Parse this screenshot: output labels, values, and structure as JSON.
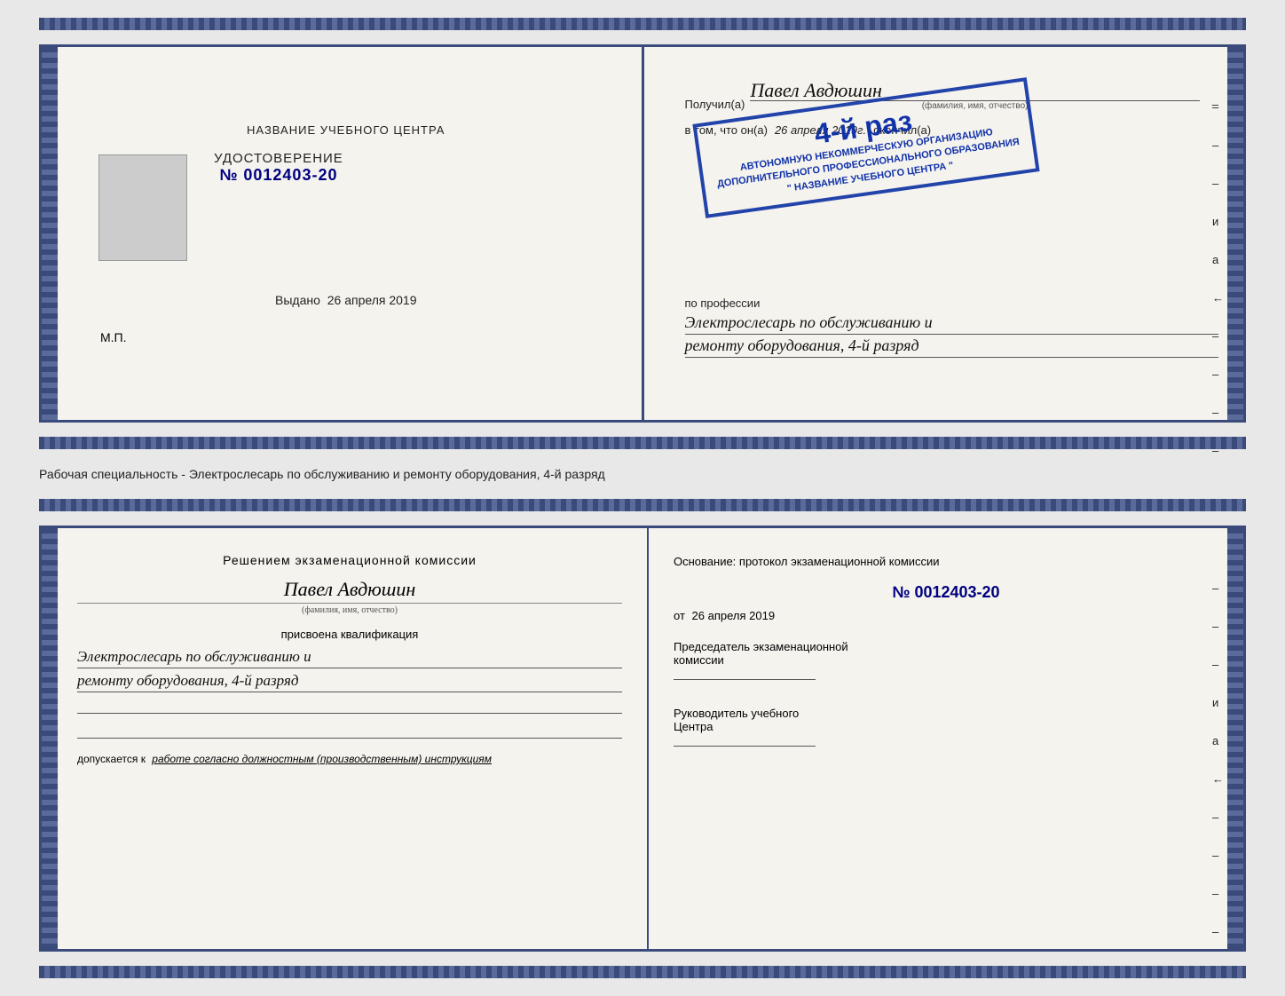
{
  "top_booklet": {
    "left": {
      "center_title": "НАЗВАНИЕ УЧЕБНОГО ЦЕНТРА",
      "doc_label": "УДОСТОВЕРЕНИЕ",
      "doc_number": "№ 0012403-20",
      "vydano_label": "Выдано",
      "vydano_date": "26 апреля 2019",
      "mp_text": "М.П."
    },
    "right": {
      "poluchil_label": "Получил(a)",
      "recipient_name": "Павел Авдюшин",
      "fio_sublabel": "(фамилия, имя, отчество)",
      "vtom_label": "в том, что он(a)",
      "date_italic": "26 апреля 2019г.",
      "okonchil_label": "окончил(a)",
      "stamp_line1": "4-й раз",
      "stamp_org1": "АВТОНОМНУЮ НЕКОММЕРЧЕСКУЮ ОРГАНИЗАЦИЮ",
      "stamp_org2": "ДОПОЛНИТЕЛЬНОГО ПРОФЕССИОНАЛЬНОГО ОБРАЗОВАНИЯ",
      "stamp_name": "\" НАЗВАНИЕ УЧЕБНОГО ЦЕНТРА \"",
      "profession_label": "по профессии",
      "profession_value1": "Электрослесарь по обслуживанию и",
      "profession_value2": "ремонту оборудования, 4-й разряд"
    }
  },
  "separator": {
    "text": "Рабочая специальность - Электрослесарь по обслуживанию и ремонту оборудования, 4-й разряд"
  },
  "bottom_booklet": {
    "left": {
      "decision_title": "Решением экзаменационной комиссии",
      "name_handwritten": "Павел Авдюшин",
      "fio_sublabel": "(фамилия, имя, отчество)",
      "assigned_label": "присвоена квалификация",
      "qualification1": "Электрослесарь по обслуживанию и",
      "qualification2": "ремонту оборудования, 4-й разряд",
      "допускается_prefix": "допускается к",
      "допускается_value": "работе согласно должностным (производственным) инструкциям"
    },
    "right": {
      "osnov_label": "Основание: протокол экзаменационной комиссии",
      "prot_number": "№ 0012403-20",
      "ot_prefix": "от",
      "ot_date": "26 апреля 2019",
      "chairman_label1": "Председатель экзаменационной",
      "chairman_label2": "комиссии",
      "rukov_label1": "Руководитель учебного",
      "rukov_label2": "Центра"
    },
    "right_marks": [
      "–",
      "–",
      "–",
      "и",
      "а",
      "←",
      "–",
      "–",
      "–",
      "–"
    ]
  }
}
